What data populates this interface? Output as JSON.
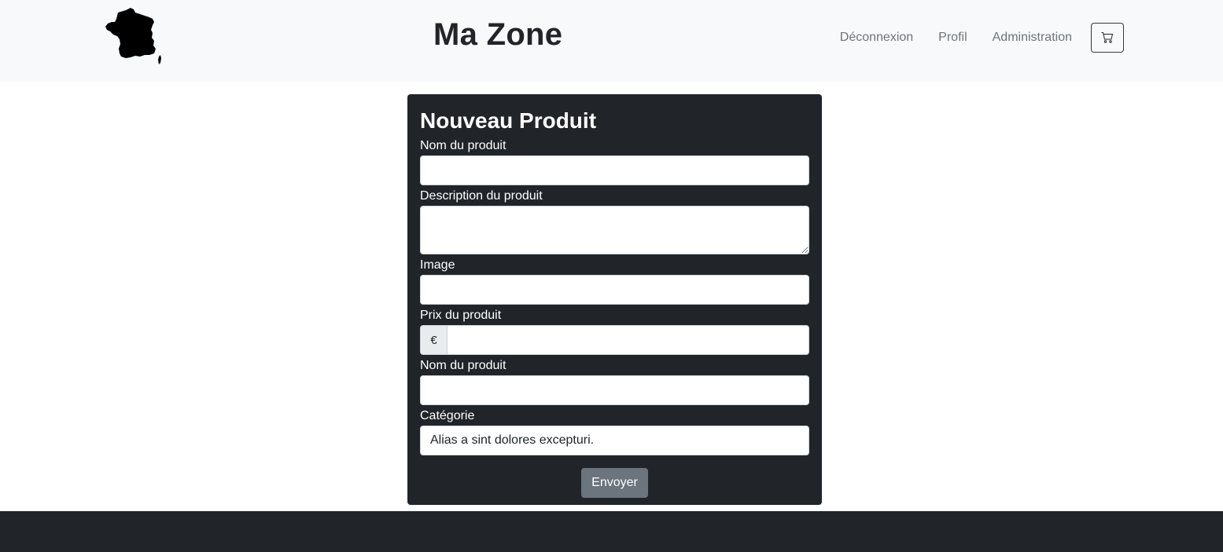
{
  "navbar": {
    "logo_icon": "france-map-icon",
    "brand": "Ma Zone",
    "links": [
      {
        "label": "Déconnexion"
      },
      {
        "label": "Profil"
      },
      {
        "label": "Administration"
      }
    ],
    "cart_icon": "cart-icon"
  },
  "form": {
    "title": "Nouveau Produit",
    "fields": {
      "name_label": "Nom du produit",
      "name_value": "",
      "description_label": "Description du produit",
      "description_value": "",
      "image_label": "Image",
      "image_value": "",
      "price_label": "Prix du produit",
      "price_prefix": "€",
      "price_value": "",
      "name2_label": "Nom du produit",
      "name2_value": "",
      "category_label": "Catégorie",
      "category_value": "Alias a sint dolores excepturi."
    },
    "submit_label": "Envoyer"
  },
  "colors": {
    "navbar_bg": "#f8f9fa",
    "card_bg": "#212529",
    "footer_bg": "#212529",
    "button_bg": "#6c757d",
    "link_color": "#6c757d"
  }
}
